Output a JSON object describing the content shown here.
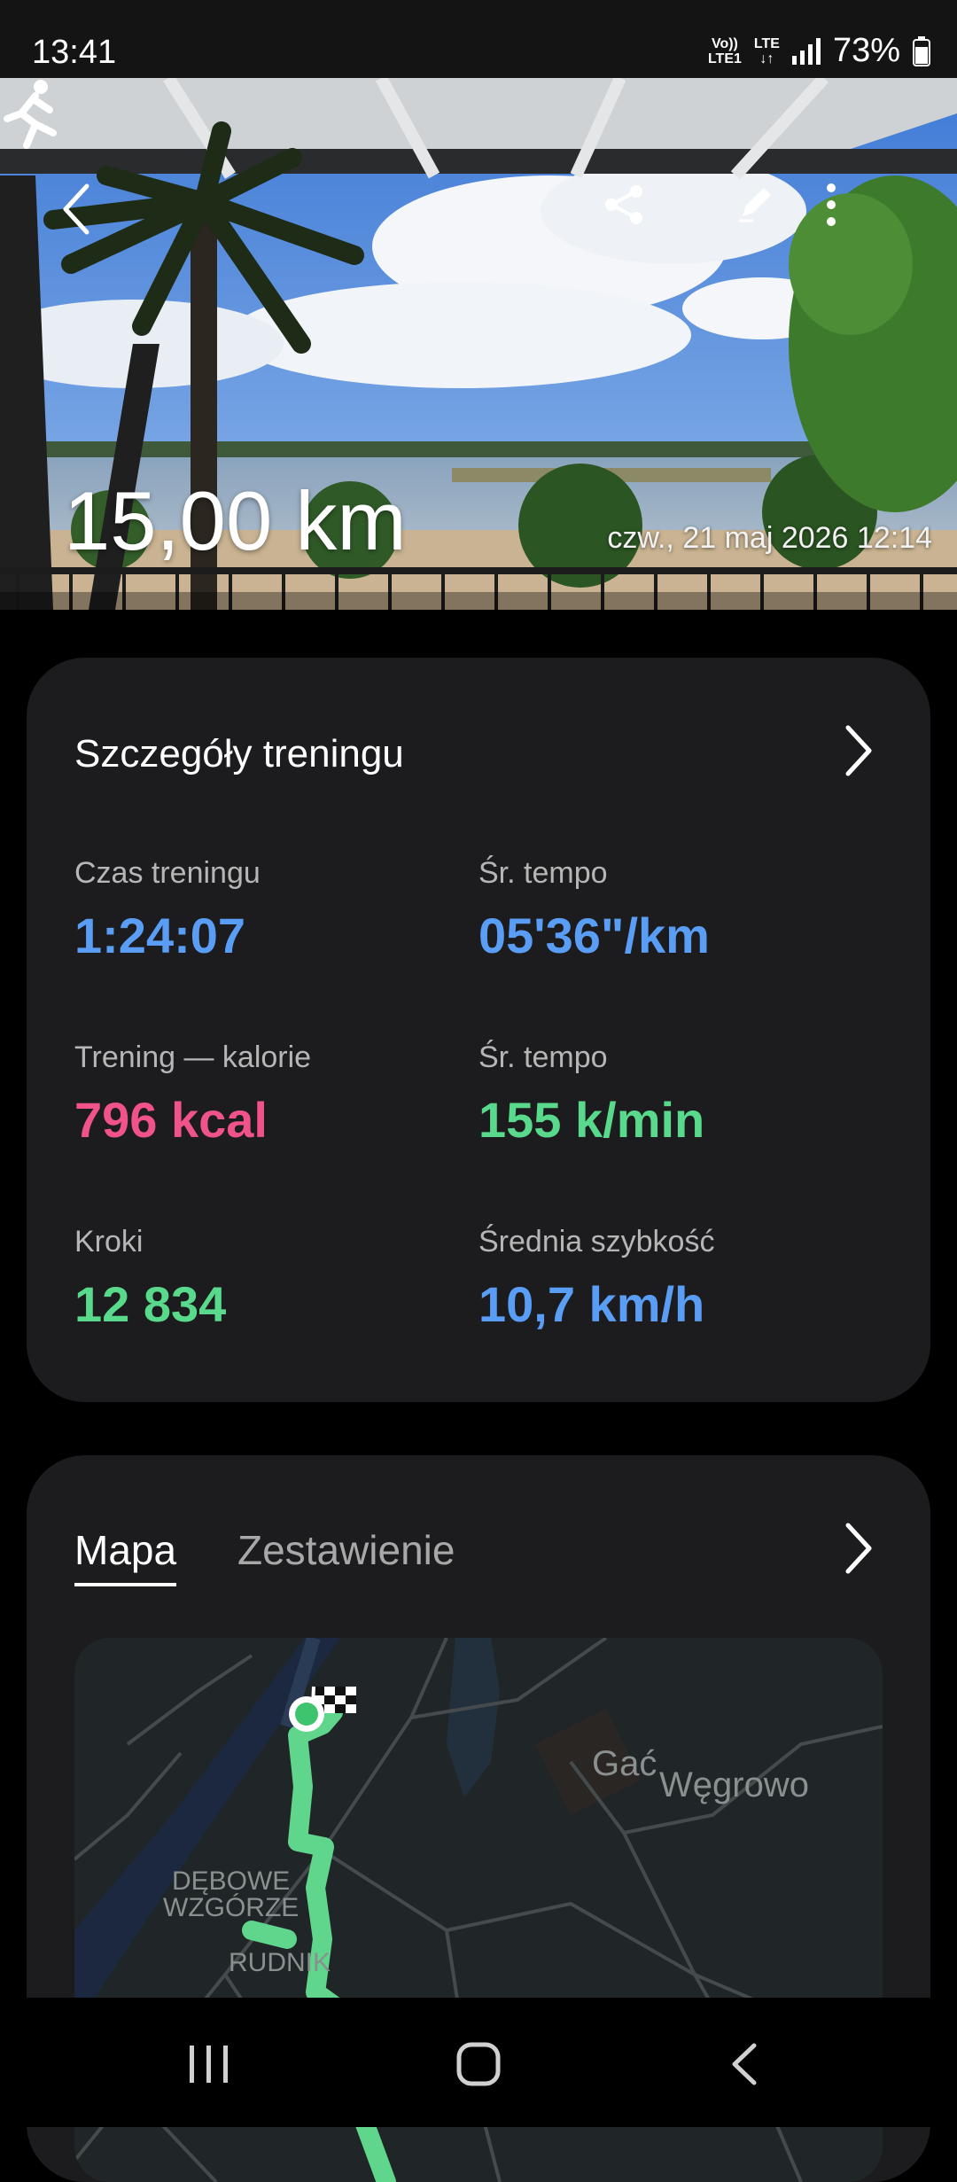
{
  "status": {
    "time": "13:41",
    "volte": [
      "Vo))",
      "LTE1"
    ],
    "lte": "LTE",
    "battery": "73%"
  },
  "hero": {
    "distance": "15,00 km",
    "date": "czw., 21 maj 2026 12:14"
  },
  "details": {
    "title": "Szczegóły treningu",
    "stats": [
      {
        "label": "Czas treningu",
        "value": "1:24:07"
      },
      {
        "label": "Śr. tempo",
        "value": "05'36\"/km"
      },
      {
        "label": "Trening — kalorie",
        "value": "796 kcal"
      },
      {
        "label": "Śr. tempo",
        "value": "155 k/min"
      },
      {
        "label": "Kroki",
        "value": "12 834"
      },
      {
        "label": "Średnia szybkość",
        "value": "10,7 km/h"
      }
    ]
  },
  "map_card": {
    "tabs": [
      "Mapa",
      "Zestawienie"
    ],
    "labels": {
      "gac": "Gać",
      "wegrowo": "Węgrowo",
      "debowe_1": "DĘBOWE",
      "debowe_2": "WZGÓRZE",
      "rudnik": "RUDNIK"
    }
  },
  "colors": {
    "blue": "#5a9df5",
    "pink": "#f0538a",
    "green": "#59d98b",
    "card": "#1c1c1e",
    "route": "#5fd68c"
  },
  "icons": [
    "back-icon",
    "share-icon",
    "edit-icon",
    "more-icon",
    "running-icon",
    "chevron-right-icon",
    "recent-apps-icon",
    "home-icon",
    "nav-back-icon"
  ]
}
